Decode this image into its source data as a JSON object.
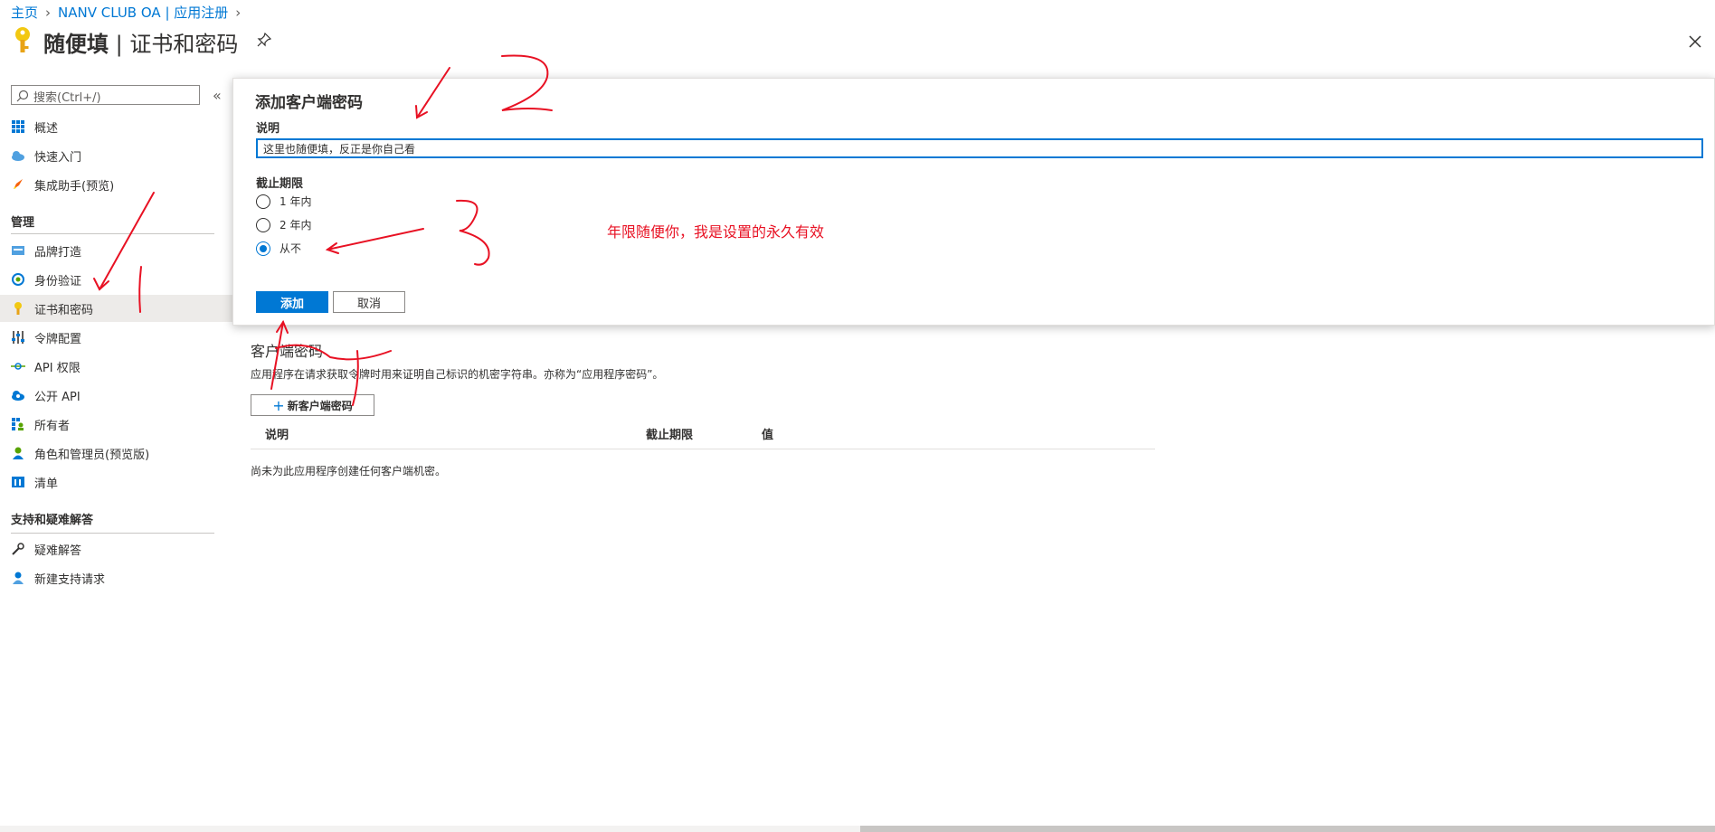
{
  "breadcrumb": {
    "home": "主页",
    "app": "NANV CLUB OA | 应用注册"
  },
  "header": {
    "app_name": "随便填",
    "divider": " | ",
    "page_name": "证书和密码"
  },
  "sidebar": {
    "search_placeholder": "搜索(Ctrl+/)",
    "items_top": [
      {
        "label": "概述",
        "icon": "grid-icon"
      },
      {
        "label": "快速入门",
        "icon": "cloud-icon"
      },
      {
        "label": "集成助手(预览)",
        "icon": "rocket-icon"
      }
    ],
    "section_manage": "管理",
    "items_manage": [
      {
        "label": "品牌打造",
        "icon": "branding-icon"
      },
      {
        "label": "身份验证",
        "icon": "auth-icon"
      },
      {
        "label": "证书和密码",
        "icon": "key-icon",
        "selected": true
      },
      {
        "label": "令牌配置",
        "icon": "token-icon"
      },
      {
        "label": "API 权限",
        "icon": "api-permissions-icon"
      },
      {
        "label": "公开 API",
        "icon": "cloud-api-icon"
      },
      {
        "label": "所有者",
        "icon": "owners-icon"
      },
      {
        "label": "角色和管理员(预览版)",
        "icon": "roles-icon"
      },
      {
        "label": "清单",
        "icon": "manifest-icon"
      }
    ],
    "section_support": "支持和疑难解答",
    "items_support": [
      {
        "label": "疑难解答",
        "icon": "wrench-icon"
      },
      {
        "label": "新建支持请求",
        "icon": "support-person-icon"
      }
    ]
  },
  "dialog": {
    "title": "添加客户端密码",
    "description_label": "说明",
    "description_value": "这里也随便填，反正是你自己看",
    "expires_label": "截止期限",
    "options": [
      "1 年内",
      "2 年内",
      "从不"
    ],
    "selected_option": "从不",
    "add_label": "添加",
    "cancel_label": "取消"
  },
  "annotation": {
    "note": "年限随便你，我是设置的永久有效"
  },
  "main": {
    "heading": "客户端密码",
    "description": "应用程序在请求获取令牌时用来证明自己标识的机密字符串。亦称为“应用程序密码”。",
    "new_secret_label": "新客户端密码",
    "columns": [
      "说明",
      "截止期限",
      "值"
    ],
    "empty_message": "尚未为此应用程序创建任何客户端机密。"
  },
  "colors": {
    "accent": "#0078d4",
    "annotation": "#e81123",
    "key": "#f2c811"
  }
}
